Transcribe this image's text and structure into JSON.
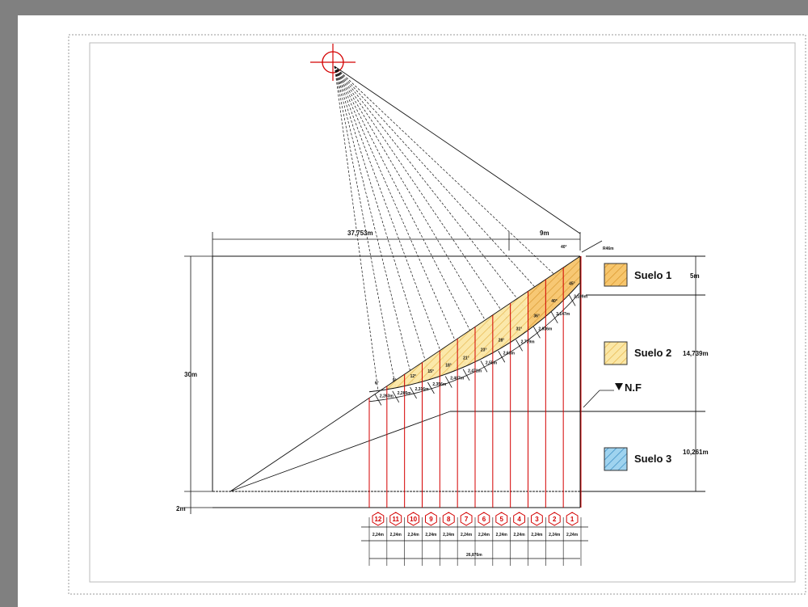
{
  "dimensions": {
    "top_width": "37,753m",
    "crest_width": "9m",
    "height_total": "30m",
    "base_offset": "2m",
    "radius": "R46m",
    "crest_angle": "40°",
    "total_base": "26,876m",
    "slice_width": "2,24m"
  },
  "soil_layers": [
    {
      "name": "Suelo 1",
      "thickness": "5m",
      "color": "#f7c66d",
      "hatch": "#d9962a"
    },
    {
      "name": "Suelo 2",
      "thickness": "14,739m",
      "color": "#fbe7a6",
      "hatch": "#e8b84d"
    },
    {
      "name": "Suelo 3",
      "thickness": "10,261m",
      "color": "#9fd3ef",
      "hatch": "#3d8fc4"
    }
  ],
  "water_level_label": "N.F",
  "slices": [
    {
      "number": "1",
      "angle": "45°",
      "arc_length": "3,109m"
    },
    {
      "number": "2",
      "angle": "40°",
      "arc_length": "3,147m"
    },
    {
      "number": "3",
      "angle": "36°",
      "arc_length": "2,936m"
    },
    {
      "number": "4",
      "angle": "31°",
      "arc_length": "2,779m"
    },
    {
      "number": "5",
      "angle": "28°",
      "arc_length": "2,63m"
    },
    {
      "number": "6",
      "angle": "23°",
      "arc_length": "2,55m"
    },
    {
      "number": "7",
      "angle": "21°",
      "arc_length": "2,471m"
    },
    {
      "number": "8",
      "angle": "18°",
      "arc_length": "2,407m"
    },
    {
      "number": "9",
      "angle": "15°",
      "arc_length": "2,356m"
    },
    {
      "number": "10",
      "angle": "12°",
      "arc_length": "2,316m"
    },
    {
      "number": "11",
      "angle": "9°",
      "arc_length": "2,285m"
    },
    {
      "number": "12",
      "angle": "6°",
      "arc_length": "2,263m"
    }
  ]
}
